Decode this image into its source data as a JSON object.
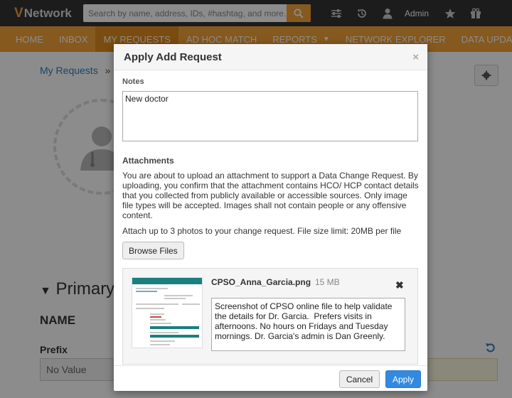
{
  "header": {
    "logo_mark": "V",
    "logo_text": "Network",
    "search_placeholder": "Search by name, address, IDs, #hashtag, and more...",
    "admin_label": "Admin"
  },
  "nav": {
    "items": [
      {
        "label": "HOME"
      },
      {
        "label": "INBOX"
      },
      {
        "label": "MY REQUESTS"
      },
      {
        "label": "AD HOC MATCH"
      },
      {
        "label": "REPORTS"
      },
      {
        "label": "NETWORK EXPLORER"
      },
      {
        "label": "DATA UPDATER"
      }
    ],
    "active_index": 2
  },
  "page": {
    "breadcrumb": "My Requests",
    "breadcrumb_sep": "»",
    "section_title": "Primary",
    "name_heading": "NAME",
    "prefix_label": "Prefix",
    "prefix_value": "No Value"
  },
  "modal": {
    "title": "Apply Add Request",
    "close": "×",
    "notes_label": "Notes",
    "notes_value": "New doctor",
    "attachments_label": "Attachments",
    "attachments_text": "You are about to upload an attachment to support a Data Change Request. By uploading, you confirm that the attachment contains HCO/ HCP contact details that you collected from publicly available or accessible sources. Only image file types will be accepted. Images shall not contain people or any offensive content.",
    "limit_text": "Attach up to 3 photos to your change request. File size limit: 20MB per file",
    "browse_label": "Browse Files",
    "attachment": {
      "file_name": "CPSO_Anna_Garcia.png",
      "file_size": "15 MB",
      "remove": "✖",
      "description": "Screenshot of CPSO online file to help validate the details for Dr. Garcia.  Prefers visits in afternoons. No hours on Fridays and Tuesday mornings. Dr. Garcia's admin is Dan Greenly."
    },
    "cancel_label": "Cancel",
    "apply_label": "Apply"
  },
  "colors": {
    "brand_orange": "#f5a23a",
    "header_dark": "#333333",
    "primary_blue": "#3389df"
  }
}
